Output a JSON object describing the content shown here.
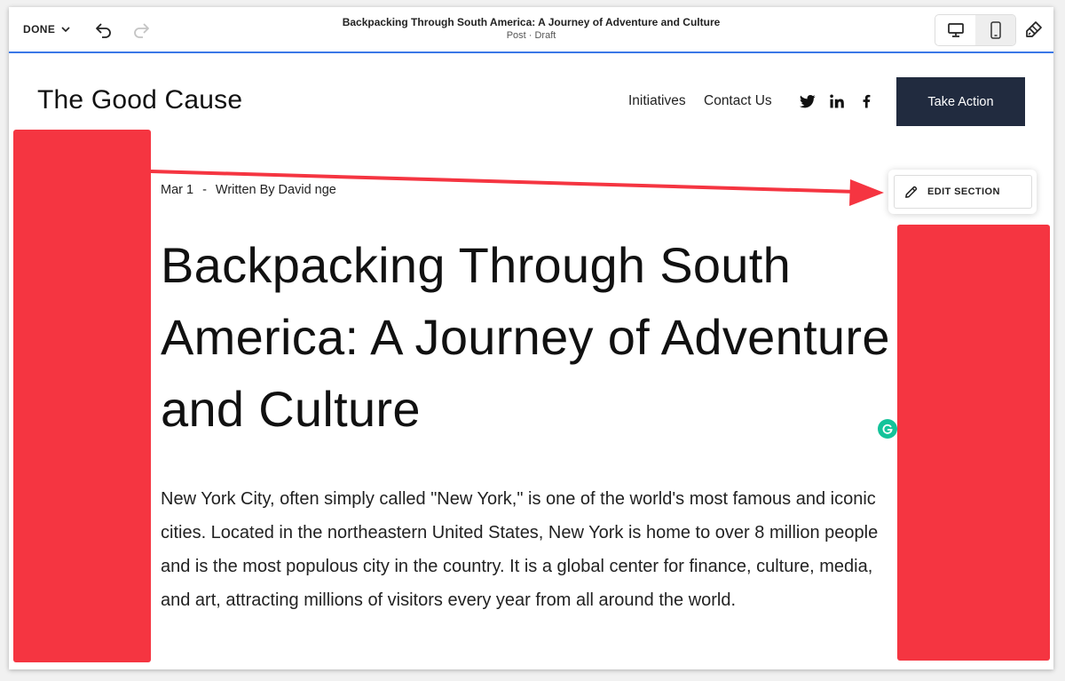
{
  "toolbar": {
    "done_label": "DONE",
    "doc_title": "Backpacking Through South America: A Journey of Adventure and Culture",
    "doc_status": "Post · Draft"
  },
  "site": {
    "title": "The Good Cause",
    "nav": [
      "Initiatives",
      "Contact Us"
    ],
    "social_icons": [
      "twitter-icon",
      "linkedin-icon",
      "facebook-icon"
    ],
    "cta_label": "Take Action"
  },
  "post": {
    "date": "Mar 1",
    "separator": "-",
    "author": "Written By David nge",
    "title": "Backpacking Through South America: A Journey of Adventure and Culture",
    "body": "New York City, often simply called \"New York,\" is one of the world's most famous and iconic cities. Located in the northeastern United States, New York is home to over 8 million people and is the most populous city in the country. It is a global center for finance, culture, media, and art, attracting millions of visitors every year from all around the world."
  },
  "edit_section": {
    "label": "EDIT SECTION"
  },
  "colors": {
    "accent_blue": "#3b78e7",
    "cta_background": "#212b3f",
    "annotation_red": "#f53541",
    "grammarly_green": "#15c39a"
  }
}
